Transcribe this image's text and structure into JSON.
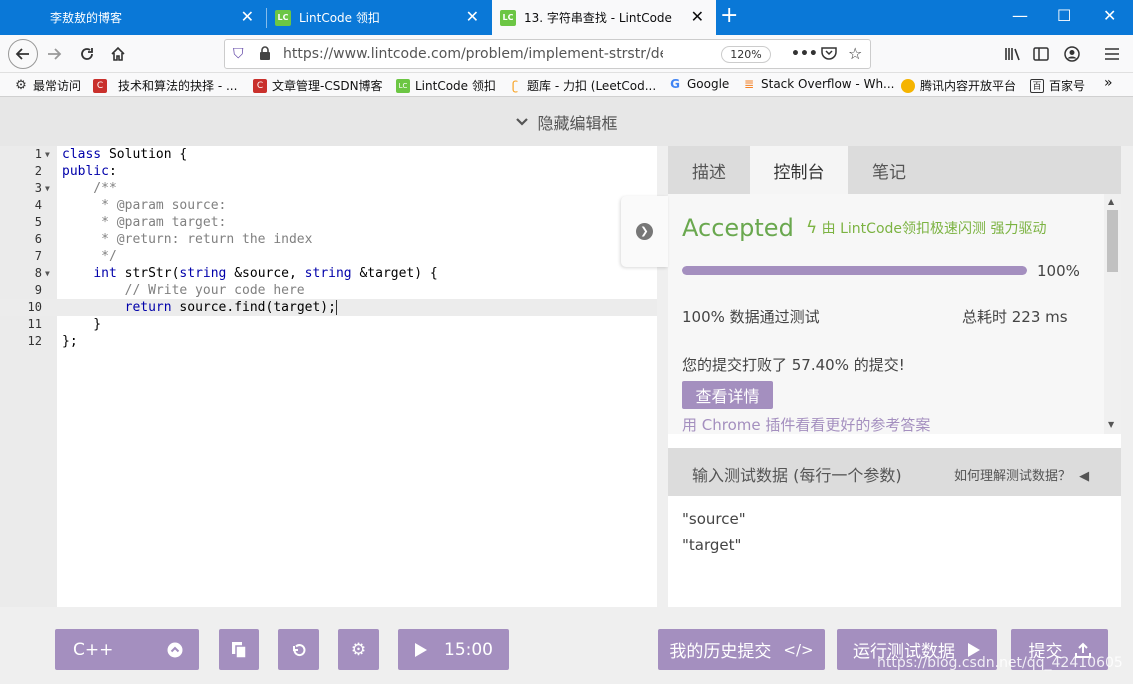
{
  "browser": {
    "tabs": [
      {
        "title": "李敖敖的博客",
        "close": "✕"
      },
      {
        "title": "LintCode 领扣",
        "favicon": "LC",
        "close": "✕"
      },
      {
        "title": "13. 字符串查找 - LintCode",
        "favicon": "LC",
        "close": "✕"
      }
    ],
    "new_tab": "+",
    "url": "https://www.lintcode.com/problem/implement-strstr/descrip",
    "zoom": "120%",
    "bookmarks": [
      {
        "label": "最常访问",
        "icon": "gear-icon"
      },
      {
        "label": "技术和算法的抉择 - ...",
        "icon": "csdn-icon"
      },
      {
        "label": "文章管理-CSDN博客",
        "icon": "csdn-icon"
      },
      {
        "label": "LintCode 领扣",
        "icon": "lintcode-icon"
      },
      {
        "label": "题库 - 力扣 (LeetCod...",
        "icon": "leetcode-icon"
      },
      {
        "label": "Google",
        "icon": "google-icon"
      },
      {
        "label": "Stack Overflow - Wh...",
        "icon": "stackoverflow-icon"
      },
      {
        "label": "腾讯内容开放平台",
        "icon": "tencent-icon"
      },
      {
        "label": "百家号",
        "icon": "baijiahao-icon"
      }
    ]
  },
  "page": {
    "hide_editor": "隐藏编辑框",
    "code_lines": [
      {
        "n": "1",
        "fold": true,
        "text": "class Solution {"
      },
      {
        "n": "2",
        "fold": false,
        "text": "public:"
      },
      {
        "n": "3",
        "fold": true,
        "text": "    /**"
      },
      {
        "n": "4",
        "fold": false,
        "text": "     * @param source:"
      },
      {
        "n": "5",
        "fold": false,
        "text": "     * @param target:"
      },
      {
        "n": "6",
        "fold": false,
        "text": "     * @return: return the index"
      },
      {
        "n": "7",
        "fold": false,
        "text": "     */"
      },
      {
        "n": "8",
        "fold": true,
        "text": "    int strStr(string &source, string &target) {"
      },
      {
        "n": "9",
        "fold": false,
        "text": "        // Write your code here"
      },
      {
        "n": "10",
        "fold": false,
        "text": "        return source.find(target);"
      },
      {
        "n": "11",
        "fold": false,
        "text": "    }"
      },
      {
        "n": "12",
        "fold": false,
        "text": "};"
      }
    ],
    "panel_tabs": [
      "描述",
      "控制台",
      "笔记"
    ],
    "console": {
      "status": "Accepted",
      "powered_by": "由 LintCode领扣极速闪测 强力驱动",
      "progress_fraction": 1.0,
      "progress_label": "100%",
      "passed": "100% 数据通过测试",
      "time": "总耗时 223 ms",
      "beat": "您的提交打败了 57.40% 的提交!",
      "details_button": "查看详情",
      "hint": "用 Chrome 插件看看更好的参考答案"
    },
    "test_input": {
      "title": "输入测试数据 (每行一个参数)",
      "help": "如何理解测试数据？",
      "lines": [
        "\"source\"",
        "\"target\""
      ]
    },
    "footer": {
      "language": "C++",
      "timer": "15:00",
      "history": "我的历史提交",
      "run": "运行测试数据",
      "submit": "提交"
    },
    "watermark": "https://blog.csdn.net/qq_42410605"
  },
  "colors": {
    "accent": "#a48fbf",
    "accepted": "#6aa84f",
    "titlebar": "#0a78d7"
  }
}
